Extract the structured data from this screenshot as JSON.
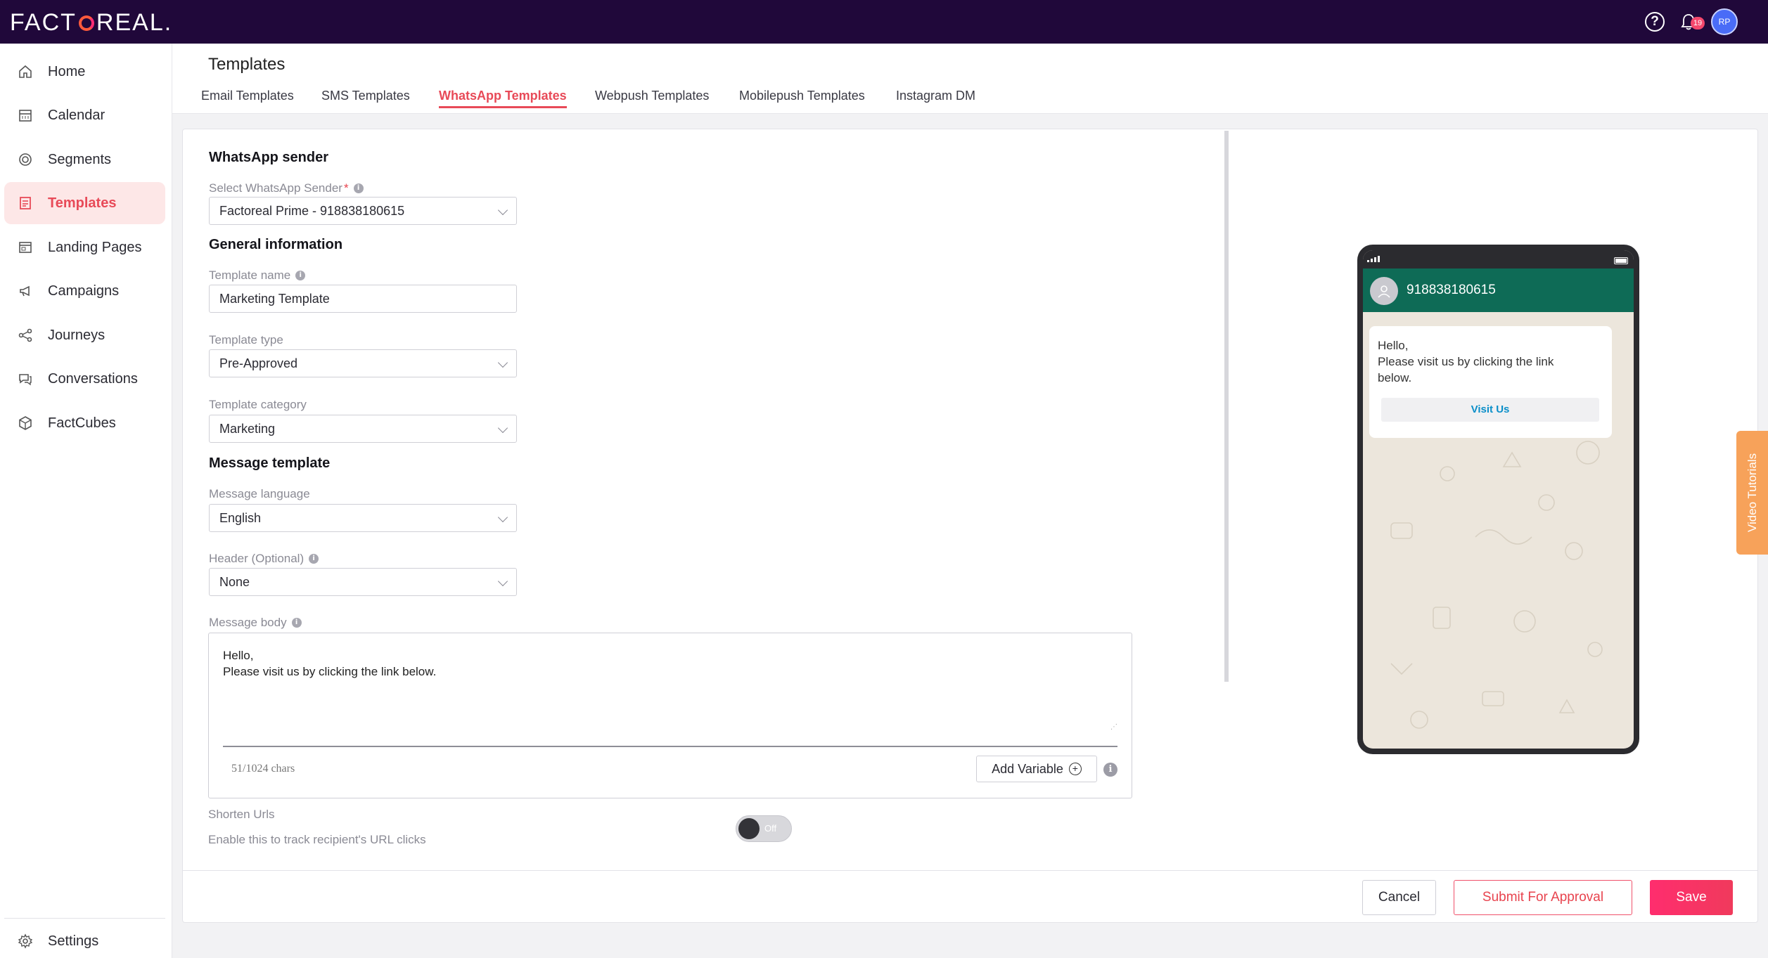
{
  "app": {
    "logo_text_left": "FACT",
    "logo_text_right": "REAL."
  },
  "topbar": {
    "help_glyph": "?",
    "notification_count": "19",
    "avatar_initials": "RP"
  },
  "sidebar": {
    "items": [
      {
        "label": "Home",
        "icon": "home-icon"
      },
      {
        "label": "Calendar",
        "icon": "calendar-icon"
      },
      {
        "label": "Segments",
        "icon": "segments-icon"
      },
      {
        "label": "Templates",
        "icon": "templates-icon",
        "active": true
      },
      {
        "label": "Landing Pages",
        "icon": "landing-pages-icon"
      },
      {
        "label": "Campaigns",
        "icon": "megaphone-icon"
      },
      {
        "label": "Journeys",
        "icon": "journeys-icon"
      },
      {
        "label": "Conversations",
        "icon": "chat-icon"
      },
      {
        "label": "FactCubes",
        "icon": "cube-icon"
      }
    ],
    "settings_label": "Settings"
  },
  "header": {
    "title": "Templates",
    "tabs": [
      {
        "label": "Email Templates"
      },
      {
        "label": "SMS Templates"
      },
      {
        "label": "WhatsApp Templates",
        "active": true
      },
      {
        "label": "Webpush Templates"
      },
      {
        "label": "Mobilepush Templates"
      },
      {
        "label": "Instagram DM"
      }
    ]
  },
  "form": {
    "sender_section": "WhatsApp sender",
    "sender_label": "Select WhatsApp Sender",
    "sender_required": "*",
    "sender_value": "Factoreal Prime - 918838180615",
    "general_section": "General information",
    "template_name_label": "Template name",
    "template_name_value": "Marketing Template",
    "template_type_label": "Template type",
    "template_type_value": "Pre-Approved",
    "template_category_label": "Template category",
    "template_category_value": "Marketing",
    "message_section": "Message template",
    "language_label": "Message language",
    "language_value": "English",
    "header_label": "Header (Optional)",
    "header_value": "None",
    "body_label": "Message body",
    "body_value": "Hello,\nPlease visit us by clicking the link below.",
    "char_count": "51/1024 chars",
    "add_variable_label": "Add Variable",
    "shorten_label": "Shorten Urls",
    "shorten_sub": "Enable this to track recipient's URL clicks",
    "toggle_label": "Off",
    "info_glyph": "i"
  },
  "preview": {
    "contact": "918838180615",
    "message": "Hello,\nPlease visit us by clicking the link\nbelow.",
    "button_label": "Visit Us"
  },
  "video_tutorials_label": "Video Tutorials",
  "footer": {
    "cancel_label": "Cancel",
    "submit_label": "Submit For Approval",
    "save_label": "Save"
  },
  "colors": {
    "topbar": "#20083a",
    "accent": "#e84a58",
    "whatsapp_header": "#0e6b56",
    "video_tab": "#f7a25a"
  }
}
